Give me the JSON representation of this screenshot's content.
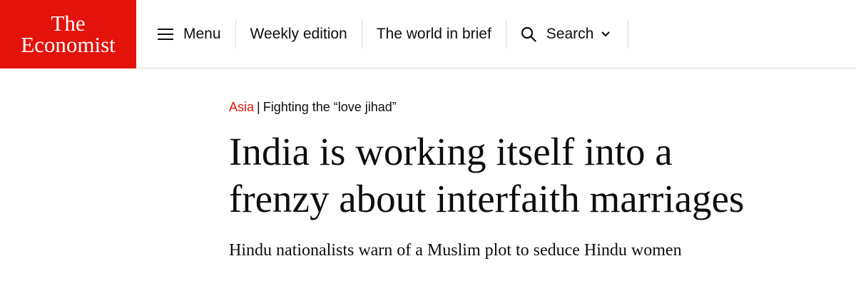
{
  "logo": {
    "line1": "The",
    "line2": "Economist"
  },
  "nav": {
    "menu_label": "Menu",
    "weekly_label": "Weekly edition",
    "brief_label": "The world in brief",
    "search_label": "Search"
  },
  "article": {
    "section": "Asia",
    "separator": "|",
    "fly_title": "Fighting the “love jihad”",
    "headline_line1": "India is working itself into a",
    "headline_line2": "frenzy about interfaith marriages",
    "subheadline": "Hindu nationalists warn of a Muslim plot to seduce Hindu women"
  },
  "colors": {
    "brand_red": "#e3120b",
    "text": "#0d0d0d",
    "divider": "#d9d9d9"
  }
}
